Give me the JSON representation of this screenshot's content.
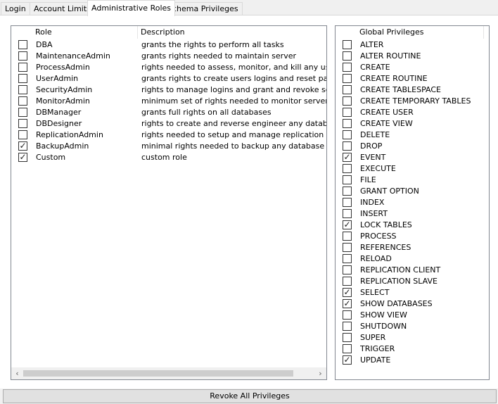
{
  "tabs": [
    "Login",
    "Account Limits",
    "Administrative Roles",
    "Schema Privileges"
  ],
  "active_tab": "Administrative Roles",
  "roles_table": {
    "columns": [
      "Role",
      "Description"
    ],
    "rows": [
      {
        "role": "DBA",
        "description": "grants the rights to perform all tasks",
        "checked": false
      },
      {
        "role": "MaintenanceAdmin",
        "description": "grants rights needed to maintain server",
        "checked": false
      },
      {
        "role": "ProcessAdmin",
        "description": "rights needed to assess, monitor, and kill any user p",
        "checked": false
      },
      {
        "role": "UserAdmin",
        "description": "grants rights to create users logins and reset passwo",
        "checked": false
      },
      {
        "role": "SecurityAdmin",
        "description": "rights to manage logins and grant and revoke server",
        "checked": false
      },
      {
        "role": "MonitorAdmin",
        "description": "minimum set of rights needed to monitor server",
        "checked": false
      },
      {
        "role": "DBManager",
        "description": "grants full rights on all databases",
        "checked": false
      },
      {
        "role": "DBDesigner",
        "description": "rights to create and reverse engineer any database s",
        "checked": false
      },
      {
        "role": "ReplicationAdmin",
        "description": "rights needed to setup and manage replication",
        "checked": false
      },
      {
        "role": "BackupAdmin",
        "description": "minimal rights needed to backup any database",
        "checked": true
      },
      {
        "role": "Custom",
        "description": "custom role",
        "checked": true
      }
    ]
  },
  "privileges_table": {
    "column": "Global Privileges",
    "rows": [
      {
        "name": "ALTER",
        "checked": false
      },
      {
        "name": "ALTER ROUTINE",
        "checked": false
      },
      {
        "name": "CREATE",
        "checked": false
      },
      {
        "name": "CREATE ROUTINE",
        "checked": false
      },
      {
        "name": "CREATE TABLESPACE",
        "checked": false
      },
      {
        "name": "CREATE TEMPORARY TABLES",
        "checked": false
      },
      {
        "name": "CREATE USER",
        "checked": false
      },
      {
        "name": "CREATE VIEW",
        "checked": false
      },
      {
        "name": "DELETE",
        "checked": false
      },
      {
        "name": "DROP",
        "checked": false
      },
      {
        "name": "EVENT",
        "checked": true
      },
      {
        "name": "EXECUTE",
        "checked": false
      },
      {
        "name": "FILE",
        "checked": false
      },
      {
        "name": "GRANT OPTION",
        "checked": false
      },
      {
        "name": "INDEX",
        "checked": false
      },
      {
        "name": "INSERT",
        "checked": false
      },
      {
        "name": "LOCK TABLES",
        "checked": true
      },
      {
        "name": "PROCESS",
        "checked": false
      },
      {
        "name": "REFERENCES",
        "checked": false
      },
      {
        "name": "RELOAD",
        "checked": false
      },
      {
        "name": "REPLICATION CLIENT",
        "checked": false
      },
      {
        "name": "REPLICATION SLAVE",
        "checked": false
      },
      {
        "name": "SELECT",
        "checked": true
      },
      {
        "name": "SHOW DATABASES",
        "checked": true
      },
      {
        "name": "SHOW VIEW",
        "checked": false
      },
      {
        "name": "SHUTDOWN",
        "checked": false
      },
      {
        "name": "SUPER",
        "checked": false
      },
      {
        "name": "TRIGGER",
        "checked": false
      },
      {
        "name": "UPDATE",
        "checked": true
      }
    ]
  },
  "scrollbar": {
    "left_arrow": "‹",
    "right_arrow": "›"
  },
  "revoke_button": "Revoke All Privileges",
  "colors": {
    "border": "#828790",
    "window_bg": "#f0f0f0",
    "button_bg": "#e1e1e1"
  }
}
